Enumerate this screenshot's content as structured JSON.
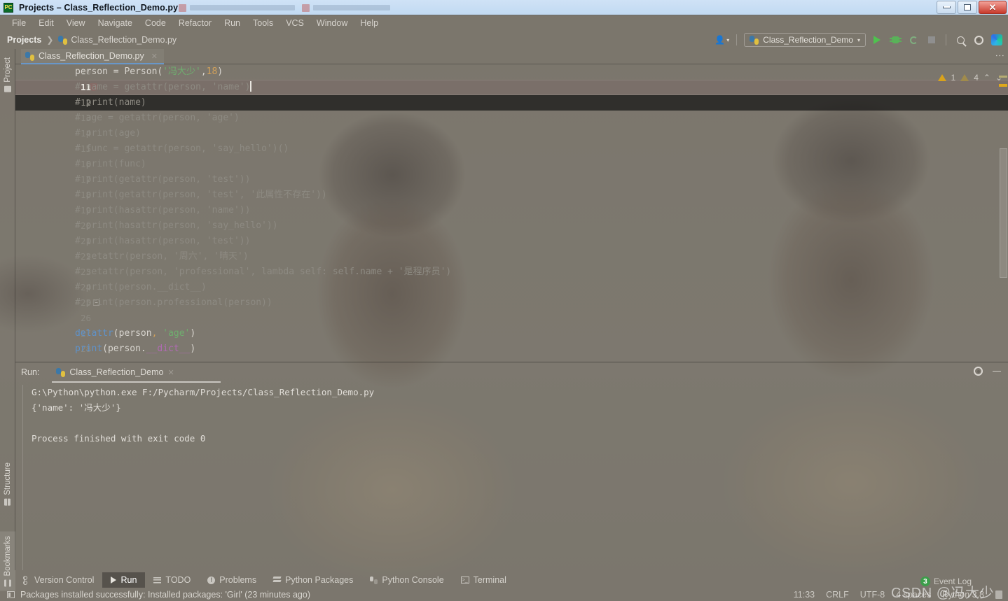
{
  "window": {
    "title": "Projects – Class_Reflection_Demo.py",
    "app_icon": "pycharm-icon",
    "minimize": "–",
    "maximize": "❐",
    "close": "✕"
  },
  "menubar": {
    "items": [
      "File",
      "Edit",
      "View",
      "Navigate",
      "Code",
      "Refactor",
      "Run",
      "Tools",
      "VCS",
      "Window",
      "Help"
    ]
  },
  "breadcrumb": {
    "root": "Projects",
    "separator": "❯",
    "file": "Class_Reflection_Demo.py"
  },
  "toolbar": {
    "run_config": "Class_Reflection_Demo",
    "run_config_caret": "▾",
    "account_caret": "▾",
    "run_button": "run-button",
    "debug_button": "debug-button",
    "coverage_button": "coverage-button",
    "stop_button": "stop-button",
    "search_button": "search-everywhere-button",
    "settings_button": "settings-button",
    "updates_button": "updates-button"
  },
  "rail": {
    "project": "Project",
    "structure": "Structure",
    "bookmarks": "Bookmarks"
  },
  "editor": {
    "tab_label": "Class_Reflection_Demo.py",
    "tab_close": "✕",
    "kebab": "⋮",
    "warnings": {
      "errors": "1",
      "warnings": "4",
      "up": "⌃",
      "down": "⌄"
    },
    "lines": [
      {
        "num": "10",
        "state": "above",
        "tokens": [
          {
            "t": "person = Person(",
            "c": "id"
          },
          {
            "t": "'冯大少'",
            "c": "str"
          },
          {
            "t": ",",
            "c": "id"
          },
          {
            "t": "18",
            "c": "num"
          },
          {
            "t": ")",
            "c": "id"
          }
        ]
      },
      {
        "num": "11",
        "state": "current",
        "tokens": [
          {
            "t": "# name = getattr(person, 'name')",
            "c": "cm"
          }
        ]
      },
      {
        "num": "12",
        "state": "dark",
        "tokens": [
          {
            "t": "# print(name)",
            "c": "cm"
          }
        ]
      },
      {
        "num": "13",
        "state": "",
        "tokens": [
          {
            "t": "# age = getattr(person, 'age')",
            "c": "cm"
          }
        ]
      },
      {
        "num": "14",
        "state": "",
        "tokens": [
          {
            "t": "# print(age)",
            "c": "cm"
          }
        ]
      },
      {
        "num": "15",
        "state": "",
        "tokens": [
          {
            "t": "# func = getattr(person, 'say_hello')()",
            "c": "cm"
          }
        ]
      },
      {
        "num": "16",
        "state": "",
        "tokens": [
          {
            "t": "# print(func)",
            "c": "cm"
          }
        ]
      },
      {
        "num": "17",
        "state": "",
        "tokens": [
          {
            "t": "# print(getattr(person, 'test'))",
            "c": "cm"
          }
        ]
      },
      {
        "num": "18",
        "state": "",
        "tokens": [
          {
            "t": "# print(getattr(person, 'test', '此属性不存在'))",
            "c": "cm"
          }
        ]
      },
      {
        "num": "19",
        "state": "",
        "tokens": [
          {
            "t": "# print(hasattr(person, 'name'))",
            "c": "cm"
          }
        ]
      },
      {
        "num": "20",
        "state": "",
        "tokens": [
          {
            "t": "# print(hasattr(person, 'say_hello'))",
            "c": "cm"
          }
        ]
      },
      {
        "num": "21",
        "state": "",
        "tokens": [
          {
            "t": "# print(hasattr(person, 'test'))",
            "c": "cm"
          }
        ]
      },
      {
        "num": "22",
        "state": "",
        "tokens": [
          {
            "t": "# setattr(person, '周六', '晴天')",
            "c": "cm"
          }
        ]
      },
      {
        "num": "23",
        "state": "",
        "tokens": [
          {
            "t": "# setattr(person, 'professional', lambda self: self.name + '是程序员')",
            "c": "cm"
          }
        ]
      },
      {
        "num": "24",
        "state": "",
        "tokens": [
          {
            "t": "# print(person.__dict__)",
            "c": "cm"
          }
        ]
      },
      {
        "num": "25",
        "state": "fold",
        "tokens": [
          {
            "t": "# print(person.professional(person))",
            "c": "cm"
          }
        ]
      },
      {
        "num": "26",
        "state": "",
        "tokens": [
          {
            "t": "",
            "c": "id"
          }
        ]
      },
      {
        "num": "27",
        "state": "",
        "tokens": [
          {
            "t": "delattr",
            "c": "kw"
          },
          {
            "t": "(person",
            "c": "id"
          },
          {
            "t": ",",
            "c": "num"
          },
          {
            "t": " ",
            "c": "id"
          },
          {
            "t": "'age'",
            "c": "str"
          },
          {
            "t": ")",
            "c": "id"
          }
        ]
      },
      {
        "num": "28",
        "state": "",
        "tokens": [
          {
            "t": "print",
            "c": "kw"
          },
          {
            "t": "(person.",
            "c": "id"
          },
          {
            "t": "__dict__",
            "c": "pnk"
          },
          {
            "t": ")",
            "c": "id"
          }
        ]
      }
    ]
  },
  "run_panel": {
    "label": "Run:",
    "tab": "Class_Reflection_Demo",
    "tab_close": "✕",
    "settings_icon": "gear-icon",
    "minimize_icon": "minimize-icon",
    "console": [
      "G:\\Python\\python.exe F:/Pycharm/Projects/Class_Reflection_Demo.py",
      "{'name': '冯大少'}",
      "",
      "Process finished with exit code 0"
    ]
  },
  "bottom_bar": {
    "items": [
      {
        "label": "Version Control",
        "icon": "branch-icon",
        "active": false
      },
      {
        "label": "Run",
        "icon": "play-icon",
        "active": true
      },
      {
        "label": "TODO",
        "icon": "list-icon",
        "active": false
      },
      {
        "label": "Problems",
        "icon": "exclamation-icon",
        "active": false
      },
      {
        "label": "Python Packages",
        "icon": "stack-icon",
        "active": false
      },
      {
        "label": "Python Console",
        "icon": "python-icon",
        "active": false
      },
      {
        "label": "Terminal",
        "icon": "terminal-icon",
        "active": false
      }
    ]
  },
  "status_bar": {
    "message": "Packages installed successfully: Installed packages: 'Girl' (23 minutes ago)",
    "time": "11:33",
    "line_separator": "CRLF",
    "encoding": "UTF-8",
    "indent": "4 spaces",
    "interpreter": "Python 3.8"
  },
  "event_log": {
    "label": "Event Log",
    "count": "3"
  },
  "watermark": "CSDN @冯大少",
  "colors": {
    "titlebar": "#c6dcf3",
    "accent_blue": "#6897c9",
    "run_green": "#4fc24f",
    "warning_yellow": "#d8a21c",
    "string_green": "#6fae6f",
    "keyword_blue": "#5f92c9",
    "magic_pink": "#b06ab3",
    "badge_green": "#3c9e4a"
  }
}
